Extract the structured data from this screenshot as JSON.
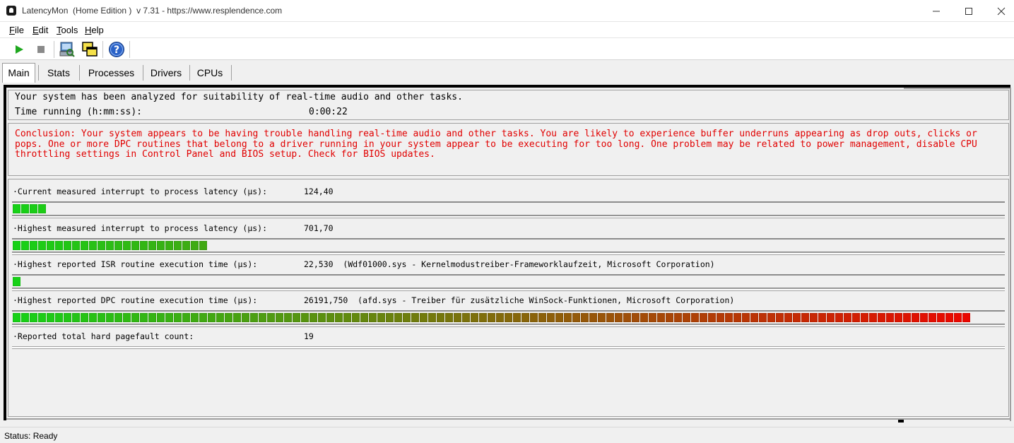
{
  "window": {
    "title": "LatencyMon  (Home Edition )  v 7.31 - https://www.resplendence.com",
    "minimize_icon": "minimize-icon",
    "maximize_icon": "maximize-icon",
    "close_icon": "close-icon"
  },
  "menu": {
    "items": [
      "File",
      "Edit",
      "Tools",
      "Help"
    ]
  },
  "toolbar": {
    "buttons": [
      "play-icon",
      "stop-icon",
      "driver-search-icon",
      "windows-icon",
      "help-icon"
    ]
  },
  "tabs": {
    "items": [
      "Main",
      "Stats",
      "Processes",
      "Drivers",
      "CPUs"
    ],
    "active": "Main"
  },
  "summary": {
    "analyzed_text": "Your system has been analyzed for suitability of real-time audio and other tasks.",
    "time_label": "Time running (h:mm:ss):",
    "time_value": "0:00:22"
  },
  "conclusion": {
    "text": "Conclusion: Your system appears to be having trouble handling real-time audio and other tasks. You are likely to experience buffer underruns appearing as drop outs, clicks or pops. One or more DPC routines that belong to a driver running in your system appear to be executing for too long. One problem may be related to power management, disable CPU throttling settings in Control Panel and BIOS setup. Check for BIOS updates.",
    "color": "#e10000"
  },
  "metrics": [
    {
      "label": "·Current measured interrupt to process latency (µs):",
      "value": "124,40",
      "detail": "",
      "segments": 4
    },
    {
      "label": "·Highest measured interrupt to process latency (µs):",
      "value": "701,70",
      "detail": "",
      "segments": 23
    },
    {
      "label": "·Highest reported ISR routine execution time (µs):",
      "value": "22,530",
      "detail": "(Wdf01000.sys - Kernelmodustreiber-Frameworklaufzeit, Microsoft Corporation)",
      "segments": 1
    },
    {
      "label": "·Highest reported DPC routine execution time (µs):",
      "value": "26191,750",
      "detail": "(afd.sys - Treiber für zusätzliche WinSock-Funktionen, Microsoft Corporation)",
      "segments": 113
    },
    {
      "label": "·Reported total hard pagefault count:",
      "value": "19",
      "detail": "",
      "segments": 0
    }
  ],
  "colors": {
    "bar_start": "#17d117",
    "bar_end": "#f20000"
  },
  "status": {
    "text": "Status: Ready"
  }
}
